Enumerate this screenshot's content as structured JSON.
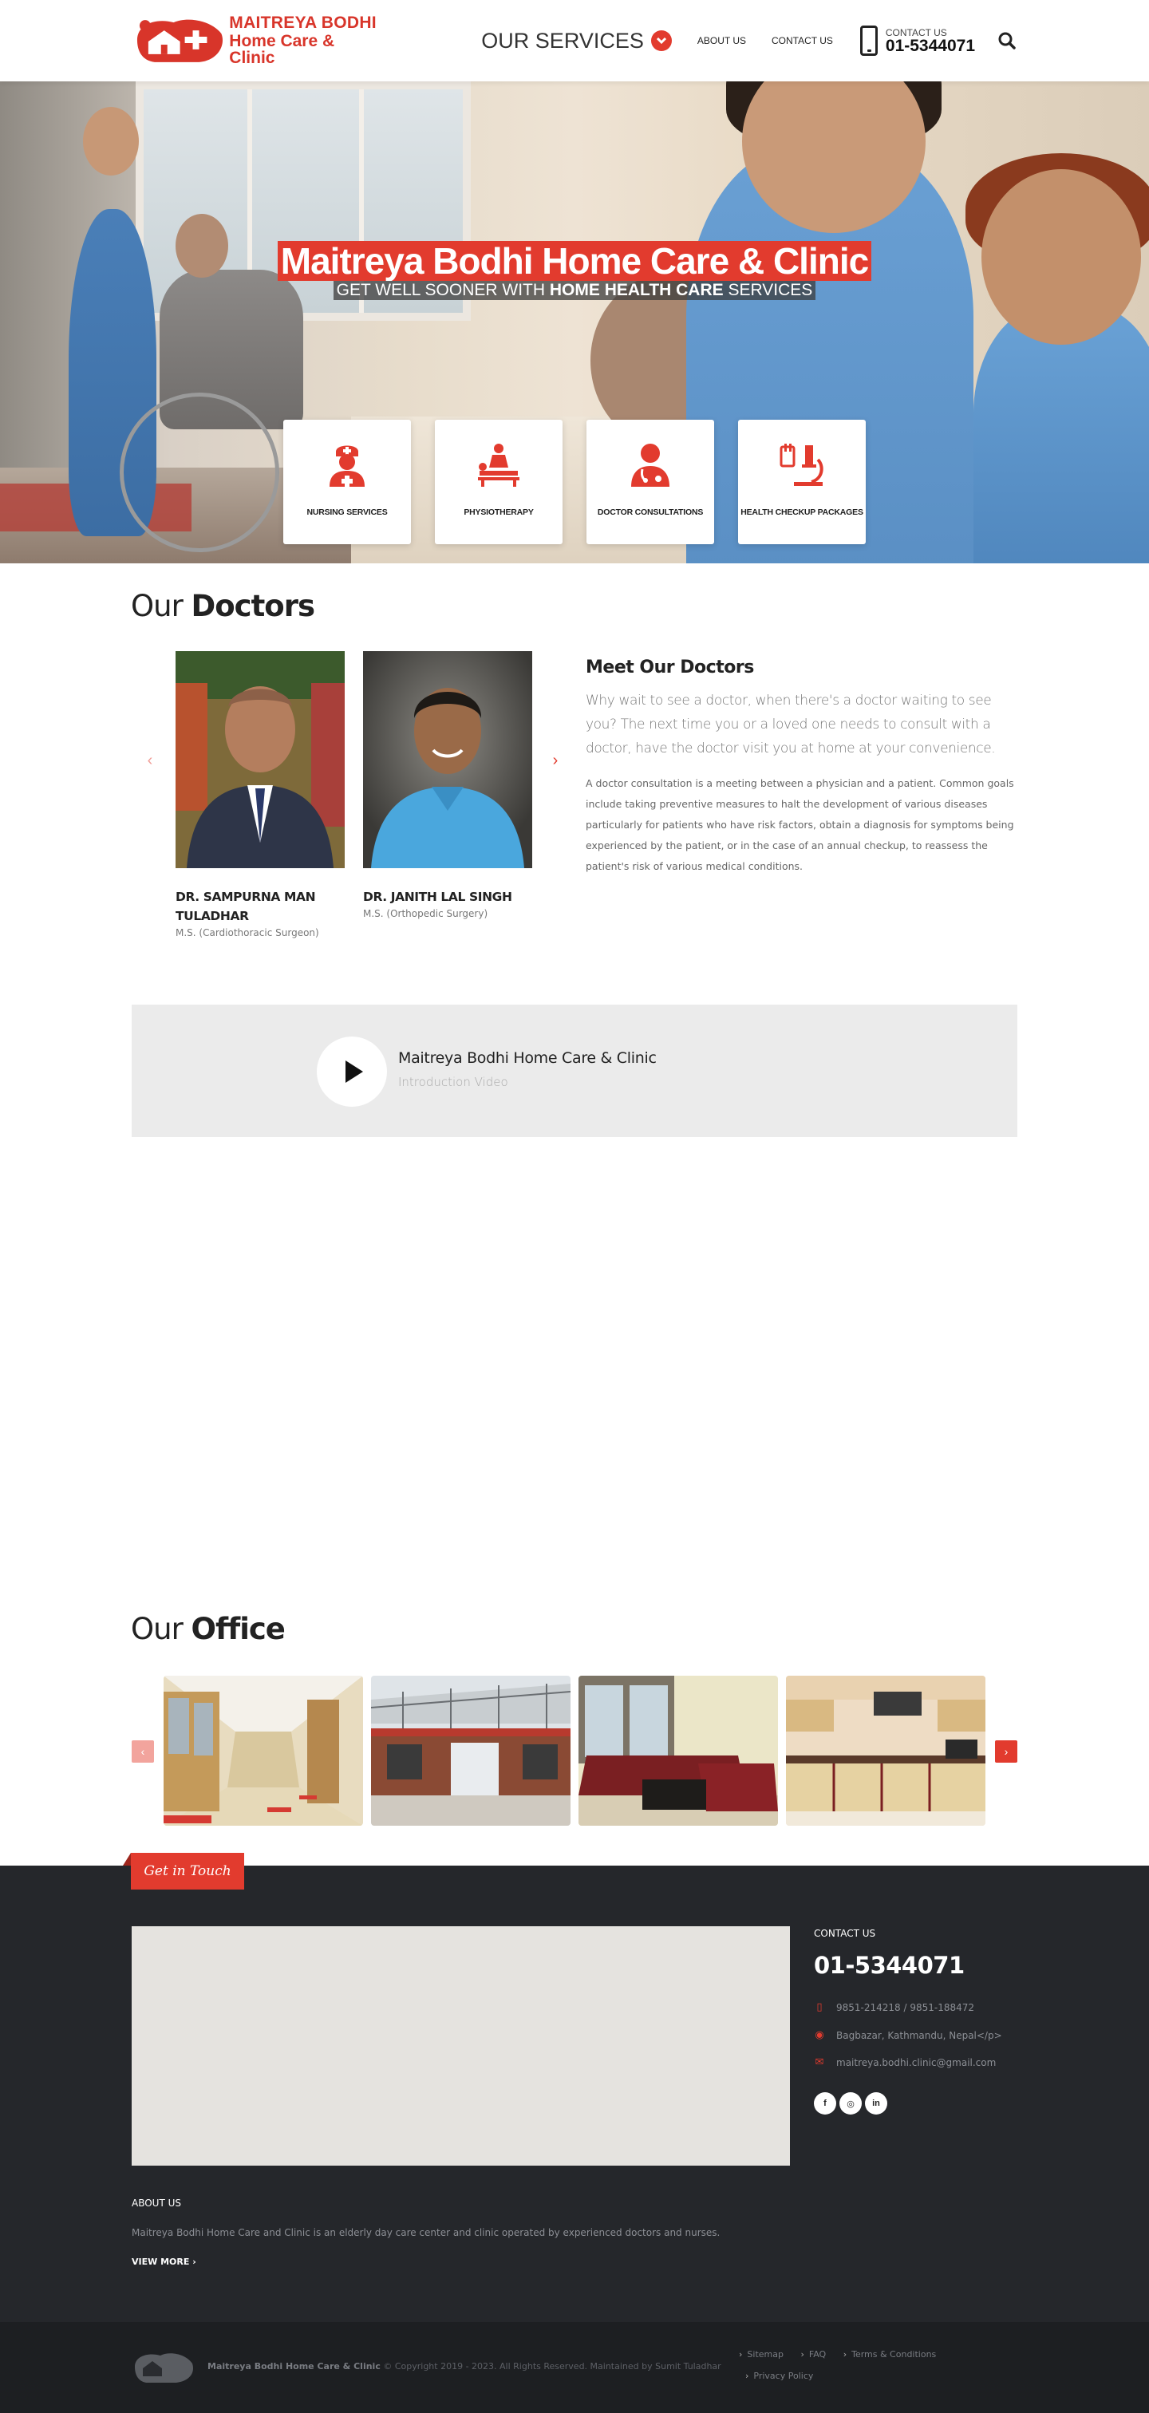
{
  "header": {
    "logo_line1": "MAITREYA BODHI",
    "logo_line2": "Home Care & Clinic",
    "nav_services": "OUR SERVICES",
    "nav_about": "ABOUT US",
    "nav_contact": "CONTACT US",
    "contact_label": "CONTACT US",
    "contact_number": "01-5344071",
    "icons": [
      "chevron-down-icon",
      "phone-icon",
      "search-icon"
    ]
  },
  "hero": {
    "title_bold": "Maitreya Bodhi",
    "title_rest": " Home Care & Clinic",
    "subtitle_pre": "GET WELL SOONER WITH ",
    "subtitle_bold": "HOME HEALTH CARE",
    "subtitle_post": " SERVICES",
    "services": [
      {
        "label": "NURSING SERVICES",
        "icon": "nurse-icon"
      },
      {
        "label": "PHYSIOTHERAPY",
        "icon": "massage-icon"
      },
      {
        "label": "DOCTOR CONSULTATIONS",
        "icon": "doctor-icon"
      },
      {
        "label": "HEALTH CHECKUP PACKAGES",
        "icon": "microscope-icon"
      }
    ]
  },
  "doctors": {
    "title_light": "Our ",
    "title_bold": "Doctors",
    "cards": [
      {
        "name": "DR. SAMPURNA MAN TULADHAR",
        "degree": "M.S. (Cardiothoracic Surgeon)"
      },
      {
        "name": "DR. JANITH LAL SINGH",
        "degree": "M.S. (Orthopedic Surgery)"
      }
    ],
    "meet_light": "Meet ",
    "meet_bold": "Our Doctors",
    "meet_lead": "Why wait to see a doctor, when there's a doctor waiting to see you? The next time you or a loved one needs to consult with a doctor, have the doctor visit you at home at your convenience.",
    "meet_body": "A doctor consultation is a meeting between a physician and a patient. Common goals include taking preventive measures to halt the development of various diseases particularly for patients who have risk factors, obtain a diagnosis for symptoms being experienced by the patient, or in the case of an annual checkup, to reassess the patient's risk of various medical conditions."
  },
  "video": {
    "title": "Maitreya Bodhi Home Care & Clinic",
    "subtitle": "Introduction Video"
  },
  "office": {
    "title_light": "Our ",
    "title_bold": "Office"
  },
  "footer": {
    "get_in_touch": "Get in Touch",
    "contact_label": "CONTACT US",
    "contact_number": "01-5344071",
    "mobile": "9851-214218 / 9851-188472",
    "address": "Bagbazar, Kathmandu, Nepal</p>",
    "email": "maitreya.bodhi.clinic@gmail.com",
    "socials": [
      "facebook-icon",
      "instagram-icon",
      "linkedin-icon"
    ],
    "about_label": "ABOUT US",
    "about_text": "Maitreya Bodhi Home Care and Clinic is an elderly day care center and clinic operated by experienced doctors and nurses.",
    "view_more": "VIEW MORE",
    "copyright_bold": "Maitreya Bodhi Home Care & Clinic",
    "copyright_rest": " © Copyright 2019 - 2023. All Rights Reserved. Maintained by Sumit Tuladhar",
    "links": [
      "Sitemap",
      "FAQ",
      "Terms & Conditions",
      "Privacy Policy"
    ]
  },
  "colors": {
    "accent": "#e23b2e",
    "footer_bg": "#25272b",
    "bottom_bg": "#1d1f22"
  }
}
